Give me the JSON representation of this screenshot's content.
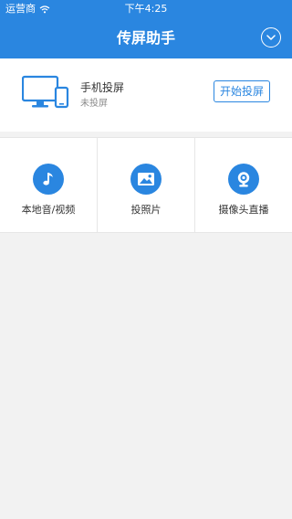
{
  "status": {
    "carrier": "运营商",
    "time": "下午4:25"
  },
  "nav": {
    "title": "传屏助手",
    "menu_icon": "chevron-down-circle-icon"
  },
  "casting": {
    "title": "手机投屏",
    "status": "未投屏",
    "button_label": "开始投屏",
    "icon": "monitor-phone-icon"
  },
  "tiles": [
    {
      "label": "本地音/视频",
      "icon": "music-note-icon"
    },
    {
      "label": "投照片",
      "icon": "image-icon"
    },
    {
      "label": "摄像头直播",
      "icon": "webcam-icon"
    }
  ],
  "colors": {
    "accent": "#2a86e0",
    "background": "#f2f2f2"
  }
}
